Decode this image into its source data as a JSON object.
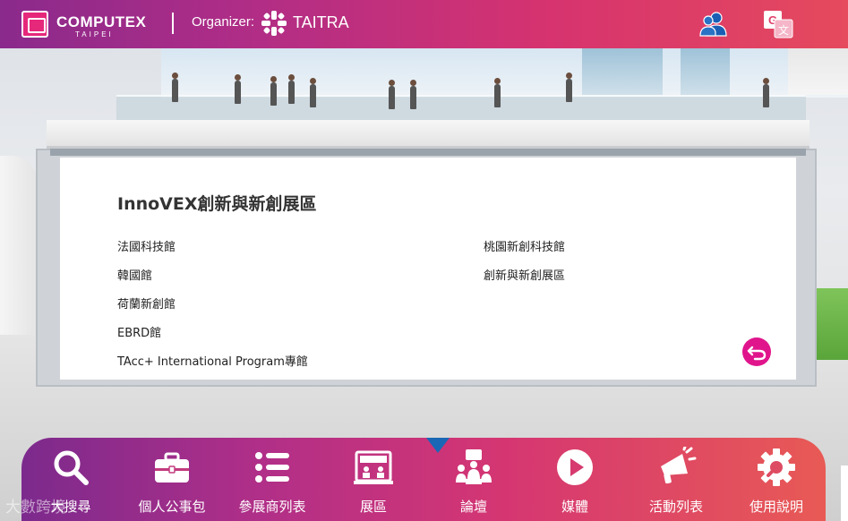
{
  "header": {
    "brand_name": "COMPUTEX",
    "brand_sub": "TAIPEI",
    "organizer_label": "Organizer:",
    "organizer_name": "TAITRA",
    "icons": [
      "users-icon",
      "translate-icon"
    ]
  },
  "panel": {
    "title": "InnoVEX創新與新創展區",
    "left_items": [
      "法國科技館",
      "韓國館",
      "荷蘭新創館",
      "EBRD館",
      "TAcc+ International Program專館"
    ],
    "right_items": [
      "桃園新創科技館",
      "創新與新創展區"
    ],
    "back_icon": "return-arrow-icon"
  },
  "nav": {
    "items": [
      {
        "label": "大搜尋",
        "icon": "search-icon"
      },
      {
        "label": "個人公事包",
        "icon": "briefcase-icon"
      },
      {
        "label": "參展商列表",
        "icon": "list-icon"
      },
      {
        "label": "展區",
        "icon": "exhibition-hall-icon"
      },
      {
        "label": "論壇",
        "icon": "forum-icon"
      },
      {
        "label": "媒體",
        "icon": "play-icon"
      },
      {
        "label": "活動列表",
        "icon": "megaphone-icon"
      },
      {
        "label": "使用說明",
        "icon": "gear-icon"
      }
    ],
    "active_index": 4
  },
  "watermark": "大數跨境",
  "colors": {
    "accent": "#e0158c",
    "pointer": "#1a67b5",
    "header_start": "#8a2a8c",
    "header_end": "#e54a5d"
  }
}
